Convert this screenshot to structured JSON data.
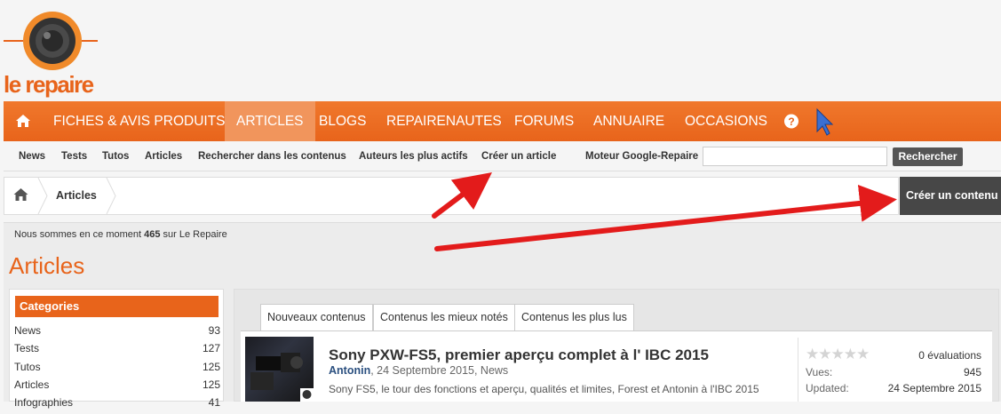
{
  "logo": {
    "text": "le repaire"
  },
  "nav": {
    "items": [
      {
        "label": "FICHES & AVIS PRODUITS"
      },
      {
        "label": "ARTICLES"
      },
      {
        "label": "BLOGS"
      },
      {
        "label": "REPAIRENAUTES"
      },
      {
        "label": "FORUMS"
      },
      {
        "label": "ANNUAIRE"
      },
      {
        "label": "OCCASIONS"
      }
    ],
    "help_label": "?"
  },
  "subnav": {
    "items": [
      {
        "label": "News"
      },
      {
        "label": "Tests"
      },
      {
        "label": "Tutos"
      },
      {
        "label": "Articles"
      },
      {
        "label": "Rechercher dans les contenus"
      },
      {
        "label": "Auteurs les plus actifs"
      },
      {
        "label": "Créer un article"
      }
    ],
    "search_label": "Moteur Google-Repaire",
    "search_value": "",
    "search_button": "Rechercher"
  },
  "breadcrumb": {
    "current": "Articles"
  },
  "create_button": "Créer un contenu",
  "online": {
    "prefix": "Nous sommes en ce moment ",
    "count": "465",
    "suffix": " sur Le Repaire"
  },
  "page_title": "Articles",
  "categories": {
    "heading": "Categories",
    "items": [
      {
        "name": "News",
        "count": "93"
      },
      {
        "name": "Tests",
        "count": "127"
      },
      {
        "name": "Tutos",
        "count": "125"
      },
      {
        "name": "Articles",
        "count": "125"
      },
      {
        "name": "Infographies",
        "count": "41"
      }
    ]
  },
  "tabs": [
    {
      "label": "Nouveaux contenus"
    },
    {
      "label": "Contenus les mieux notés"
    },
    {
      "label": "Contenus les plus lus"
    }
  ],
  "article": {
    "title": "Sony PXW-FS5, premier aperçu complet à l' IBC 2015",
    "author": "Antonin",
    "meta": ", 24 Septembre 2015, News",
    "description": "Sony FS5, le tour des fonctions et aperçu, qualités et limites, Forest et Antonin à l'IBC 2015",
    "rating_count": "0 évaluations",
    "rating": 0,
    "views_label": "Vues:",
    "views": "945",
    "updated_label": "Updated:",
    "updated": "24 Septembre 2015"
  },
  "colors": {
    "accent": "#e8641b",
    "nav_active": "#f1955c",
    "arrow": "#e31b1b",
    "cursor": "#3b6fd1"
  },
  "icons": [
    "home-icon",
    "help-icon",
    "cursor-icon",
    "arrow-icon",
    "star-icon"
  ]
}
